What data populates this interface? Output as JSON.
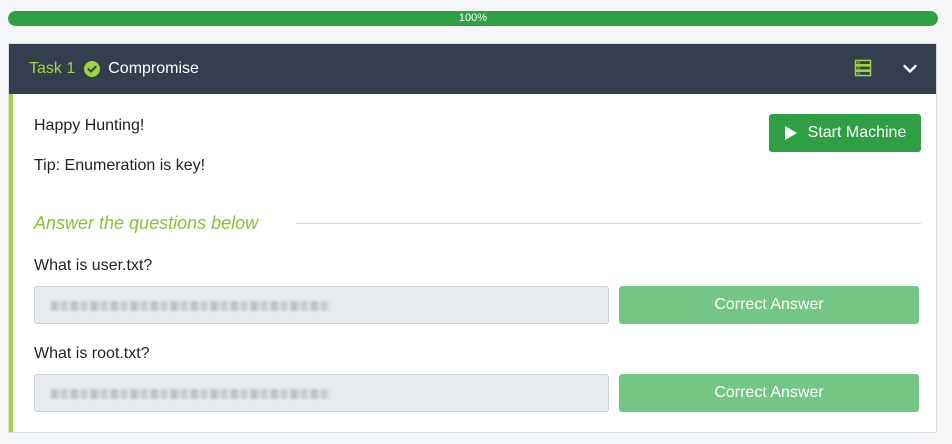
{
  "progress": {
    "label": "100%",
    "percent": 100
  },
  "task": {
    "number_label": "Task 1",
    "title": "Compromise",
    "icons": {
      "status": "check-circle-icon",
      "machine": "server-icon",
      "toggle": "chevron-down-icon"
    },
    "paragraphs": [
      "Happy Hunting!",
      "Tip: Enumeration is key!"
    ],
    "start_machine_label": "Start Machine",
    "answer_heading": "Answer the questions below",
    "questions": [
      {
        "label": "What is user.txt?",
        "button_label": "Correct Answer"
      },
      {
        "label": "What is root.txt?",
        "button_label": "Correct Answer"
      }
    ]
  },
  "colors": {
    "header_bg": "#343e4f",
    "accent_green": "#9fd33f",
    "button_green": "#2ea043",
    "correct_button": "#74c685"
  }
}
